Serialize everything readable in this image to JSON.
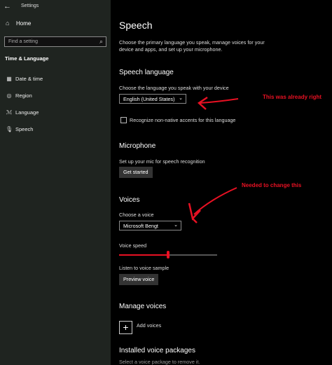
{
  "window": {
    "title": "Settings",
    "back_icon": "back-arrow-icon"
  },
  "sidebar": {
    "home_label": "Home",
    "search_placeholder": "Find a setting",
    "section_title": "Time & Language",
    "items": [
      {
        "label": "Date & time",
        "icon": "calendar-clock-icon"
      },
      {
        "label": "Region",
        "icon": "globe-icon"
      },
      {
        "label": "Language",
        "icon": "language-icon"
      },
      {
        "label": "Speech",
        "icon": "microphone-icon"
      }
    ]
  },
  "main": {
    "title": "Speech",
    "description": "Choose the primary language you speak, manage voices for your device and apps, and set up your microphone.",
    "speech_language": {
      "heading": "Speech language",
      "label": "Choose the language you speak with your device",
      "selected": "English (United States)",
      "checkbox_label": "Recognize non-native accents for this language"
    },
    "microphone": {
      "heading": "Microphone",
      "label": "Set up your mic for speech recognition",
      "button": "Get started"
    },
    "voices": {
      "heading": "Voices",
      "choose_label": "Choose a voice",
      "selected": "Microsoft Bengt",
      "speed_label": "Voice speed",
      "speed_value": 0.5,
      "sample_label": "Listen to voice sample",
      "preview_button": "Preview voice"
    },
    "manage_voices": {
      "heading": "Manage voices",
      "add_label": "Add voices"
    },
    "installed": {
      "heading": "Installed voice packages",
      "hint": "Select a voice package to remove it."
    }
  },
  "annotations": {
    "first": "This was already right",
    "second": "Needed to change this"
  },
  "colors": {
    "accent": "#e81123",
    "sidebar_bg": "#1f2420",
    "main_bg": "#000000"
  }
}
